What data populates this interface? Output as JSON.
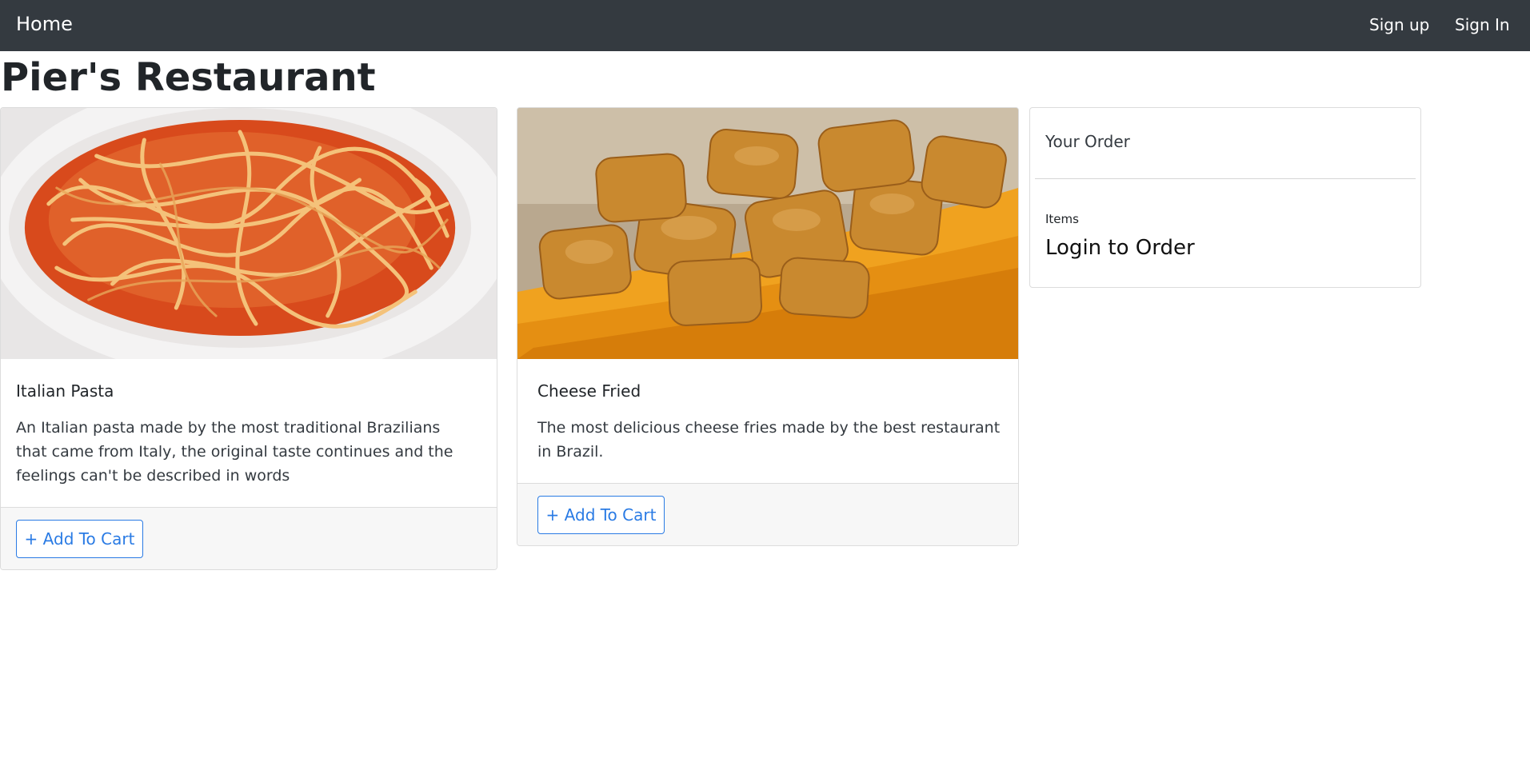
{
  "navbar": {
    "brand": "Home",
    "links": [
      "Sign up",
      "Sign In"
    ]
  },
  "page": {
    "title": "Pier's Restaurant"
  },
  "menu_items": [
    {
      "title": "Italian Pasta",
      "description": "An Italian pasta made by the most traditional Brazilians that came from Italy, the original taste continues and the feelings can't be described in words",
      "button_label": "+ Add To Cart",
      "image": "spaghetti-photo"
    },
    {
      "title": "Cheese Fried",
      "description": "The most delicious cheese fries made by the best restaurant in Brazil.",
      "button_label": "+ Add To Cart",
      "image": "cheese-fries-photo"
    }
  ],
  "order": {
    "title": "Your Order",
    "items_label": "Items",
    "login_prompt": "Login to Order"
  },
  "colors": {
    "navbar_bg": "#343a40",
    "primary": "#2a7be4",
    "footer_bg": "#f7f7f7"
  }
}
